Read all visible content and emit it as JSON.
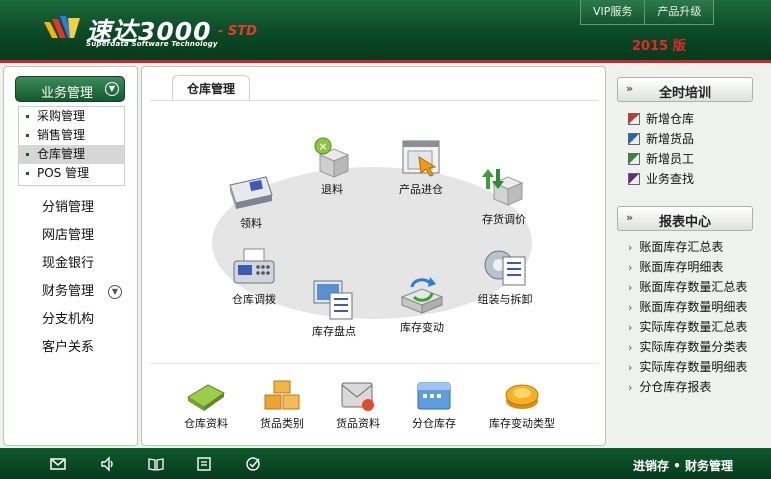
{
  "header": {
    "logo_title": "速达3000",
    "logo_edition": "- STD",
    "logo_subtitle": "Superdata Software Technology",
    "top_buttons": [
      "VIP服务",
      "产品升级"
    ],
    "version": "2015 版"
  },
  "sidebar": {
    "section": "业务管理",
    "submenu": [
      "采购管理",
      "销售管理",
      "仓库管理",
      "POS 管理"
    ],
    "active_submenu": "仓库管理",
    "nav": [
      "分销管理",
      "网店管理",
      "现金银行",
      "财务管理",
      "分支机构",
      "客户关系"
    ]
  },
  "main": {
    "tab": "仓库管理",
    "flow_icons": {
      "return": "退料",
      "inbound": "产品进仓",
      "issue": "领料",
      "price_adjust": "存货调价",
      "transfer": "仓库调拨",
      "assemble": "组装与拆卸",
      "stocktake": "库存盘点",
      "change": "库存变动"
    },
    "bottom_icons": [
      "仓库资料",
      "货品类别",
      "货品资料",
      "分仓库存",
      "库存变动类型"
    ]
  },
  "right": {
    "training_title": "全时培训",
    "training_items": [
      "新增仓库",
      "新增货品",
      "新增员工",
      "业务查找"
    ],
    "report_title": "报表中心",
    "reports": [
      "账面库存汇总表",
      "账面库存明细表",
      "账面库存数量汇总表",
      "账面库存数量明细表",
      "实际库存数量汇总表",
      "实际库存数量分类表",
      "实际库存数量明细表",
      "分仓库存报表"
    ]
  },
  "footer": {
    "text": "进销存 • 财务管理",
    "icons": [
      "mail-icon",
      "speaker-icon",
      "book-icon",
      "news-icon",
      "check-circle-icon"
    ]
  },
  "colors": {
    "header_green": "#0b4a26",
    "accent_red": "#c9252b",
    "version_red": "#e02a2a"
  }
}
